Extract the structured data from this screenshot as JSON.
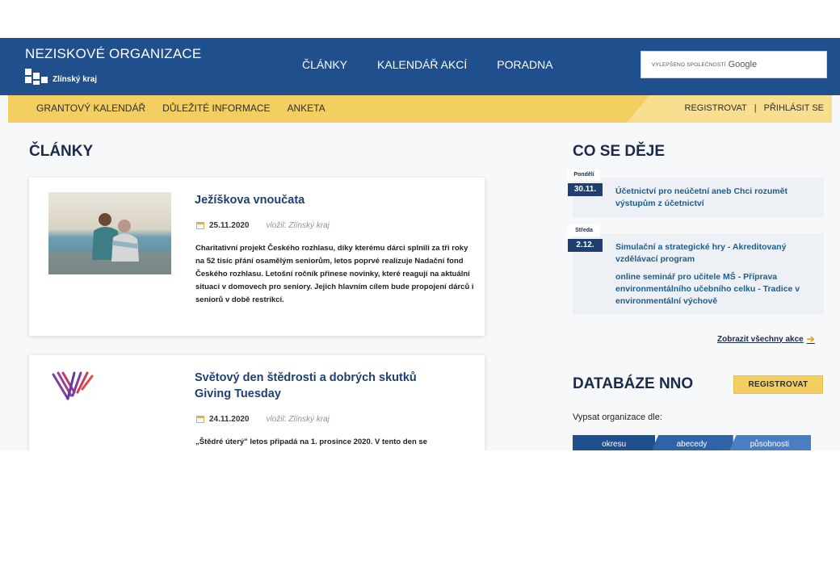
{
  "header": {
    "site_title": "NEZISKOVÉ ORGANIZACE",
    "brand_name": "Zlínský kraj",
    "nav": [
      "ČLÁNKY",
      "KALENDÁŘ AKCÍ",
      "PORADNA"
    ],
    "search": {
      "prefix": "VYLEPŠENO SPOLEČNOSTÍ",
      "engine": "Google"
    }
  },
  "subnav": {
    "items": [
      "GRANTOVÝ KALENDÁŘ",
      "DŮLEŽITÉ INFORMACE",
      "ANKETA"
    ],
    "register": "REGISTROVAT",
    "separator": "|",
    "login": "PŘIHLÁSIT SE"
  },
  "articles": {
    "heading": "ČLÁNKY",
    "items": [
      {
        "title": "Ježíškova vnoučata",
        "date": "25.11.2020",
        "author": "vložil: Zlínský kraj",
        "perex": "Charitativní projekt Českého rozhlasu, díky kterému dárci splnili za tři roky na 52 tisíc přání osamělým seniorům, letos poprvé realizuje Nadační fond Českého rozhlasu. Letošní ročník přinese novinky, které reagují na aktuální situaci v domovech pro seniory. Jejich hlavním cílem bude propojení dárců i seniorů v době restrikcí."
      },
      {
        "title": "Světový den štědrosti a dobrých skutků Giving Tuesday",
        "date": "24.11.2020",
        "author": "vložil: Zlínský kraj",
        "perex": "„Štědré úterý\" letos připadá na 1. prosince 2020. V tento den se"
      }
    ]
  },
  "events": {
    "heading": "CO SE DĚJE",
    "days": [
      {
        "day": "Pondělí",
        "date": "30.11.",
        "titles": [
          "Účetnictví pro neúčetní aneb Chci rozumět výstupům z účetnictví"
        ]
      },
      {
        "day": "Středa",
        "date": "2.12.",
        "titles": [
          "Simulační a strategické hry - Akreditovaný vzdělávací program",
          "online seminář pro učitele MŠ - Příprava environmentálního učebního celku - Tradice v environmentální výchově"
        ]
      }
    ],
    "all_link": "Zobrazit všechny akce",
    "arrow_icon": "arrow-right-icon"
  },
  "database": {
    "heading": "DATABÁZE NNO",
    "register": "REGISTROVAT",
    "label": "Vypsat organizace dle:",
    "tabs": [
      "okresu",
      "abecedy",
      "působnosti"
    ]
  },
  "colors": {
    "primary_blue": "#1f4f8d",
    "accent_yellow": "#f3cf62",
    "link_blue": "#1f5c8a"
  }
}
